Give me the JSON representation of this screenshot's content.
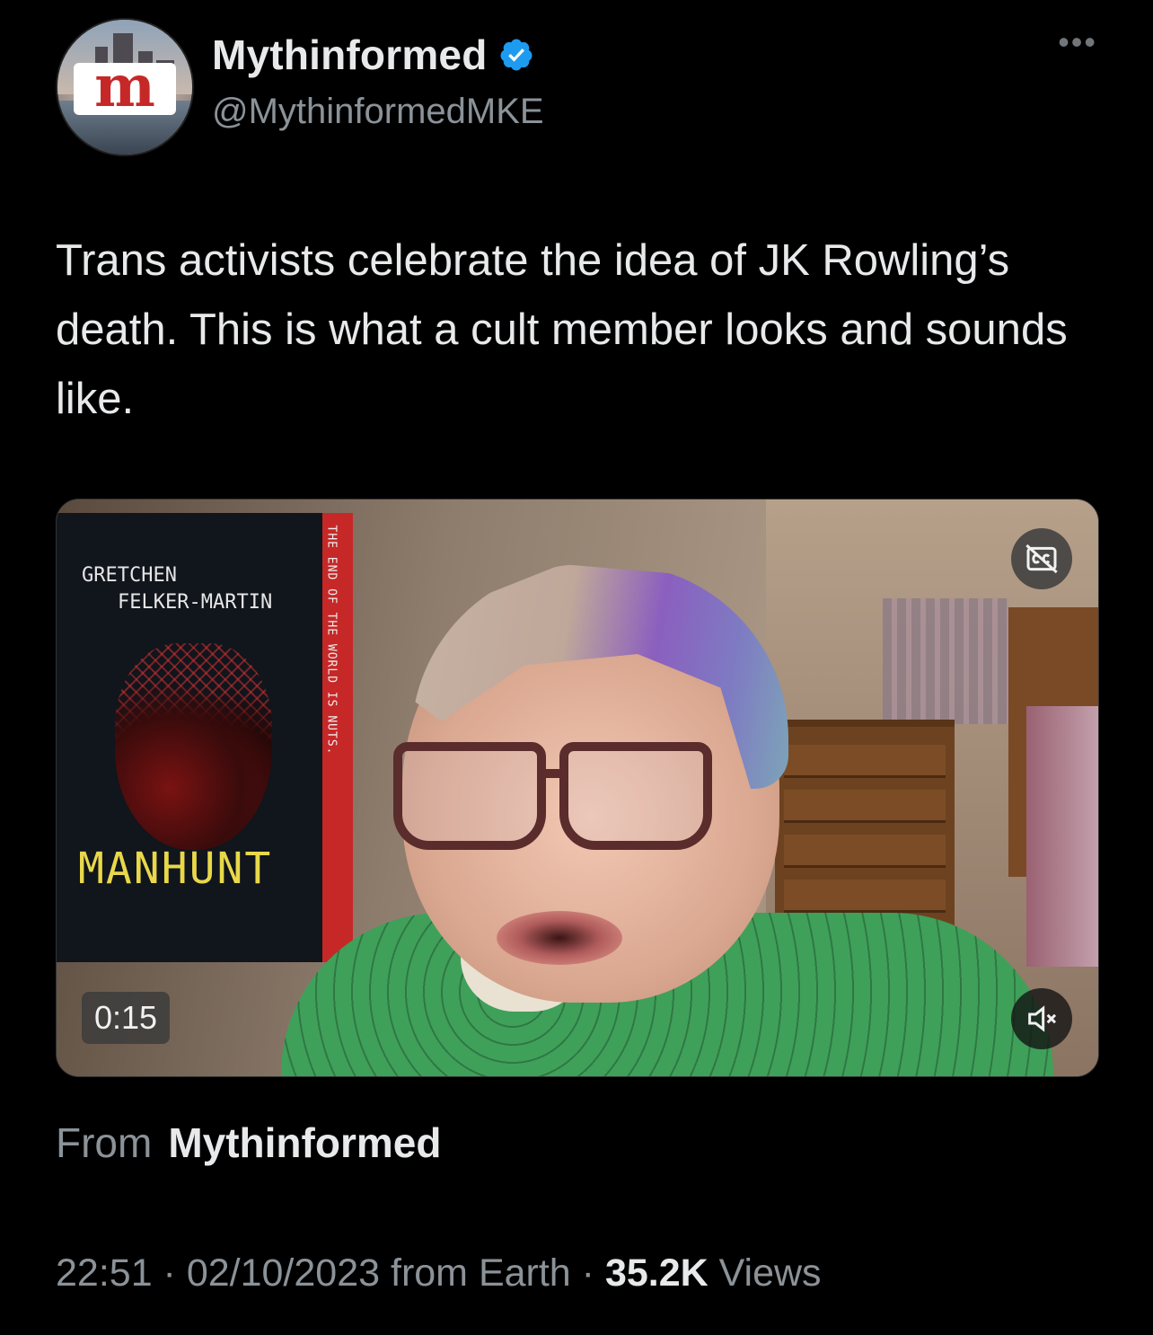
{
  "author": {
    "display_name": "Mythinformed",
    "handle": "@MythinformedMKE",
    "verified": true,
    "avatar_letter": "m",
    "accent_color": "#1d9bf0"
  },
  "post": {
    "text": "Trans activists celebrate the idea of JK Rowling’s death. This is what a cult member looks and sounds like."
  },
  "video": {
    "duration": "0:15",
    "muted": true,
    "captions_icon": "closed-captions-off-icon",
    "mute_icon": "volume-muted-icon",
    "book": {
      "author_line1": "GRETCHEN",
      "author_line2": "FELKER-MARTIN",
      "title": "MANHUNT",
      "spine": "THE END OF THE WORLD IS NUTS."
    }
  },
  "source": {
    "label": "From",
    "name": "Mythinformed"
  },
  "meta": {
    "time": "22:51",
    "sep1": " · ",
    "date": "02/10/2023",
    "location": " from Earth",
    "sep2": " · ",
    "views_count": "35.2K",
    "views_label": " Views"
  },
  "menu": {
    "more_label": "•••"
  }
}
